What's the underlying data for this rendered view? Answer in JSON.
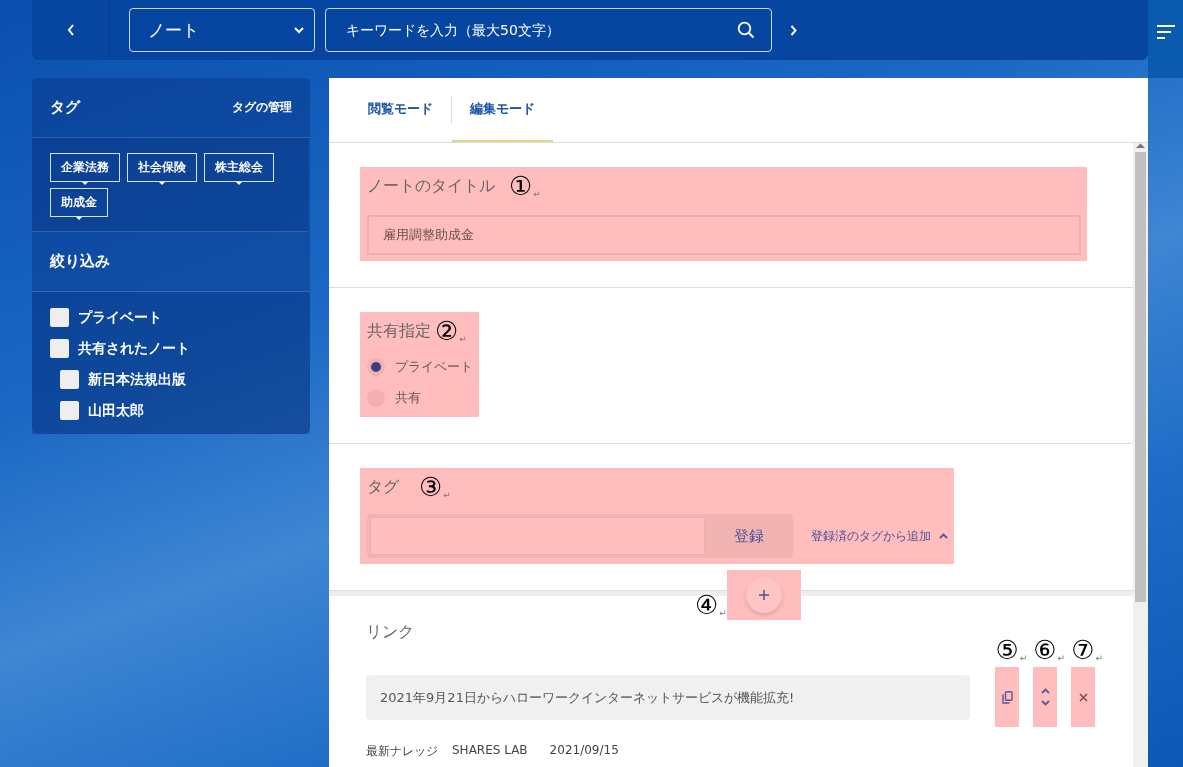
{
  "topbar": {
    "category_select": {
      "value": "ノート"
    },
    "search": {
      "placeholder": "キーワードを入力（最大50文字）"
    }
  },
  "sidebar": {
    "tags_title": "タグ",
    "manage_link": "タグの管理",
    "tags": [
      "企業法務",
      "社会保険",
      "株主総会",
      "助成金"
    ],
    "filter_title": "絞り込み",
    "filters": [
      {
        "label": "プライベート",
        "checked": false
      },
      {
        "label": "共有されたノート",
        "checked": false,
        "children": [
          {
            "label": "新日本法規出版",
            "checked": false
          },
          {
            "label": "山田太郎",
            "checked": false
          }
        ]
      }
    ]
  },
  "tabs": [
    {
      "label": "閲覧モード",
      "selected": false
    },
    {
      "label": "編集モード",
      "selected": true
    }
  ],
  "title_section": {
    "label": "ノートのタイトル",
    "value": "雇用調整助成金",
    "annotation": {
      "number": "①",
      "mark": "↵"
    }
  },
  "sharing": {
    "label": "共有指定",
    "annotation": {
      "number": "②",
      "mark": "↵"
    },
    "options": [
      {
        "label": "プライベート",
        "selected": true
      },
      {
        "label": "共有",
        "selected": false
      }
    ]
  },
  "tag_section": {
    "label": "タグ",
    "annotation": {
      "number": "③",
      "mark": "↵"
    },
    "register_button": "登録",
    "add_from_registered": "登録済のタグから追加",
    "expanded": true
  },
  "add_button": {
    "annotation": {
      "number": "④",
      "mark": "↵"
    }
  },
  "link_section": {
    "label": "リンク",
    "links": [
      {
        "title": "2021年9月21日からハローワークインターネットサービスが機能拡充!",
        "source": "最新ナレッジ",
        "site": "SHARES LAB",
        "date": "2021/09/15"
      }
    ],
    "action_annotations": [
      {
        "number": "⑤",
        "mark": "↵"
      },
      {
        "number": "⑥",
        "mark": "↵"
      },
      {
        "number": "⑦",
        "mark": "↵"
      }
    ]
  }
}
